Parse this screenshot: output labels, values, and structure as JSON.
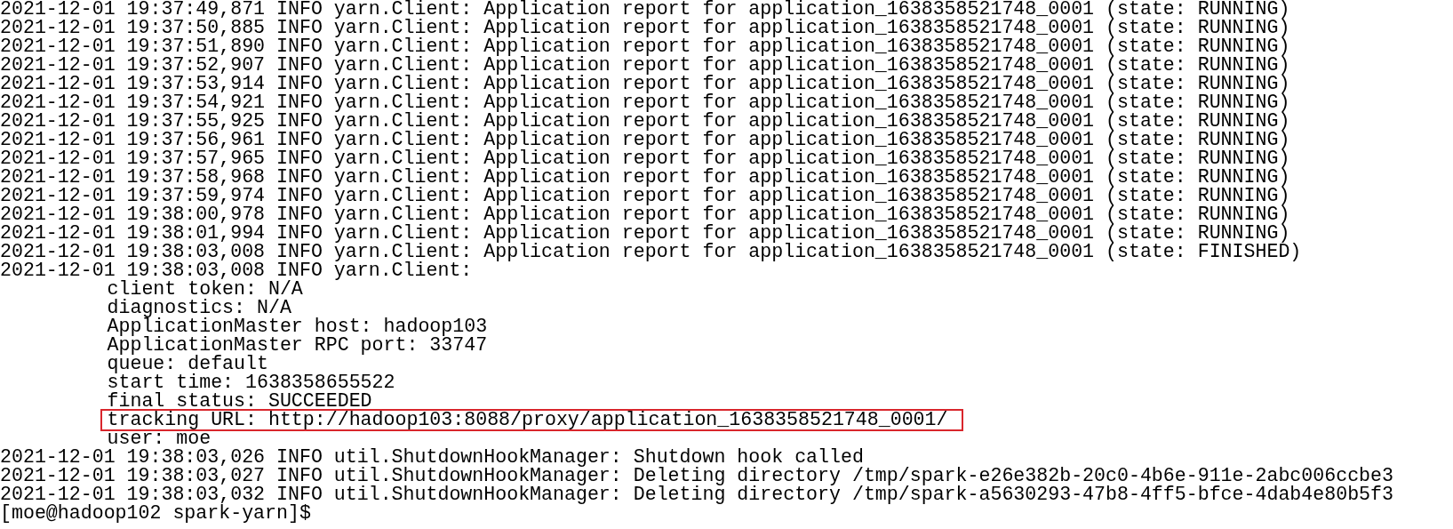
{
  "terminal": {
    "lines": [
      {
        "kind": "log",
        "text": "2021-12-01 19:37:49,871 INFO yarn.Client: Application report for application_1638358521748_0001 (state: RUNNING)",
        "highlighted": false
      },
      {
        "kind": "log",
        "text": "2021-12-01 19:37:50,885 INFO yarn.Client: Application report for application_1638358521748_0001 (state: RUNNING)",
        "highlighted": false
      },
      {
        "kind": "log",
        "text": "2021-12-01 19:37:51,890 INFO yarn.Client: Application report for application_1638358521748_0001 (state: RUNNING)",
        "highlighted": false
      },
      {
        "kind": "log",
        "text": "2021-12-01 19:37:52,907 INFO yarn.Client: Application report for application_1638358521748_0001 (state: RUNNING)",
        "highlighted": false
      },
      {
        "kind": "log",
        "text": "2021-12-01 19:37:53,914 INFO yarn.Client: Application report for application_1638358521748_0001 (state: RUNNING)",
        "highlighted": false
      },
      {
        "kind": "log",
        "text": "2021-12-01 19:37:54,921 INFO yarn.Client: Application report for application_1638358521748_0001 (state: RUNNING)",
        "highlighted": false
      },
      {
        "kind": "log",
        "text": "2021-12-01 19:37:55,925 INFO yarn.Client: Application report for application_1638358521748_0001 (state: RUNNING)",
        "highlighted": false
      },
      {
        "kind": "log",
        "text": "2021-12-01 19:37:56,961 INFO yarn.Client: Application report for application_1638358521748_0001 (state: RUNNING)",
        "highlighted": false
      },
      {
        "kind": "log",
        "text": "2021-12-01 19:37:57,965 INFO yarn.Client: Application report for application_1638358521748_0001 (state: RUNNING)",
        "highlighted": false
      },
      {
        "kind": "log",
        "text": "2021-12-01 19:37:58,968 INFO yarn.Client: Application report for application_1638358521748_0001 (state: RUNNING)",
        "highlighted": false
      },
      {
        "kind": "log",
        "text": "2021-12-01 19:37:59,974 INFO yarn.Client: Application report for application_1638358521748_0001 (state: RUNNING)",
        "highlighted": false
      },
      {
        "kind": "log",
        "text": "2021-12-01 19:38:00,978 INFO yarn.Client: Application report for application_1638358521748_0001 (state: RUNNING)",
        "highlighted": false
      },
      {
        "kind": "log",
        "text": "2021-12-01 19:38:01,994 INFO yarn.Client: Application report for application_1638358521748_0001 (state: RUNNING)",
        "highlighted": false
      },
      {
        "kind": "log",
        "text": "2021-12-01 19:38:03,008 INFO yarn.Client: Application report for application_1638358521748_0001 (state: FINISHED)",
        "highlighted": false
      },
      {
        "kind": "log",
        "text": "2021-12-01 19:38:03,008 INFO yarn.Client:",
        "highlighted": false
      },
      {
        "kind": "field",
        "text": "client token: N/A",
        "highlighted": false
      },
      {
        "kind": "field",
        "text": "diagnostics: N/A",
        "highlighted": false
      },
      {
        "kind": "field",
        "text": "ApplicationMaster host: hadoop103",
        "highlighted": false
      },
      {
        "kind": "field",
        "text": "ApplicationMaster RPC port: 33747",
        "highlighted": false
      },
      {
        "kind": "field",
        "text": "queue: default",
        "highlighted": false
      },
      {
        "kind": "field",
        "text": "start time: 1638358655522",
        "highlighted": false
      },
      {
        "kind": "field",
        "text": "final status: SUCCEEDED",
        "highlighted": false
      },
      {
        "kind": "field",
        "text": "tracking URL: http://hadoop103:8088/proxy/application_1638358521748_0001/",
        "highlighted": true
      },
      {
        "kind": "field",
        "text": "user: moe",
        "highlighted": false
      },
      {
        "kind": "log",
        "text": "2021-12-01 19:38:03,026 INFO util.ShutdownHookManager: Shutdown hook called",
        "highlighted": false
      },
      {
        "kind": "log",
        "text": "2021-12-01 19:38:03,027 INFO util.ShutdownHookManager: Deleting directory /tmp/spark-e26e382b-20c0-4b6e-911e-2abc006ccbe3",
        "highlighted": false
      },
      {
        "kind": "log",
        "text": "2021-12-01 19:38:03,032 INFO util.ShutdownHookManager: Deleting directory /tmp/spark-a5630293-47b8-4ff5-bfce-4dab4e80b5f3",
        "highlighted": false
      },
      {
        "kind": "prompt",
        "text": "[moe@hadoop102 spark-yarn]$",
        "highlighted": false
      }
    ]
  }
}
